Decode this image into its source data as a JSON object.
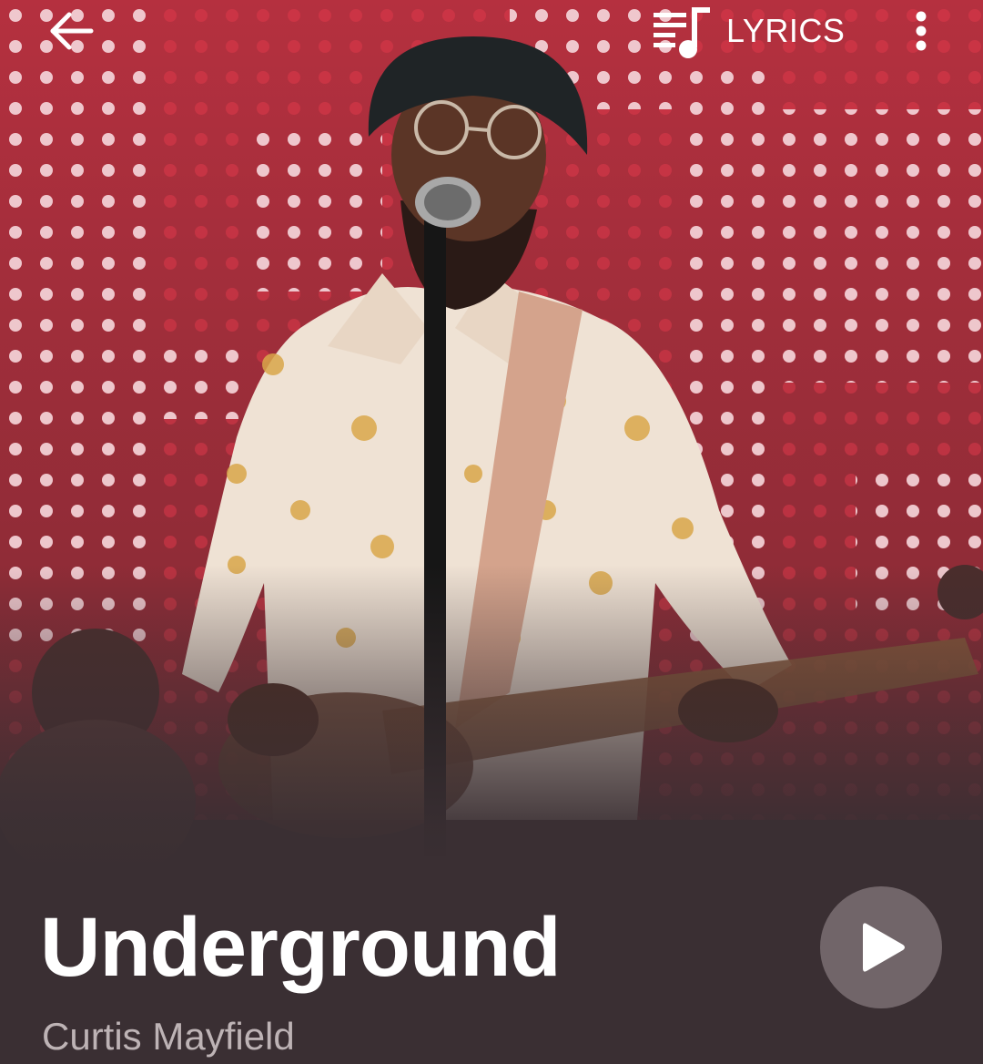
{
  "header": {
    "lyrics_label": "LYRICS",
    "back_icon": "arrow-left-icon",
    "lyrics_icon": "lyrics-note-icon",
    "more_icon": "more-vert-icon"
  },
  "song": {
    "title": "Underground",
    "artist": "Curtis Mayfield"
  },
  "controls": {
    "play_icon": "play-icon"
  },
  "colors": {
    "background": "#3a2f33",
    "artist_text": "#bdb3b5",
    "stage_red": "#b8303f",
    "play_button_bg": "#968a8d"
  }
}
